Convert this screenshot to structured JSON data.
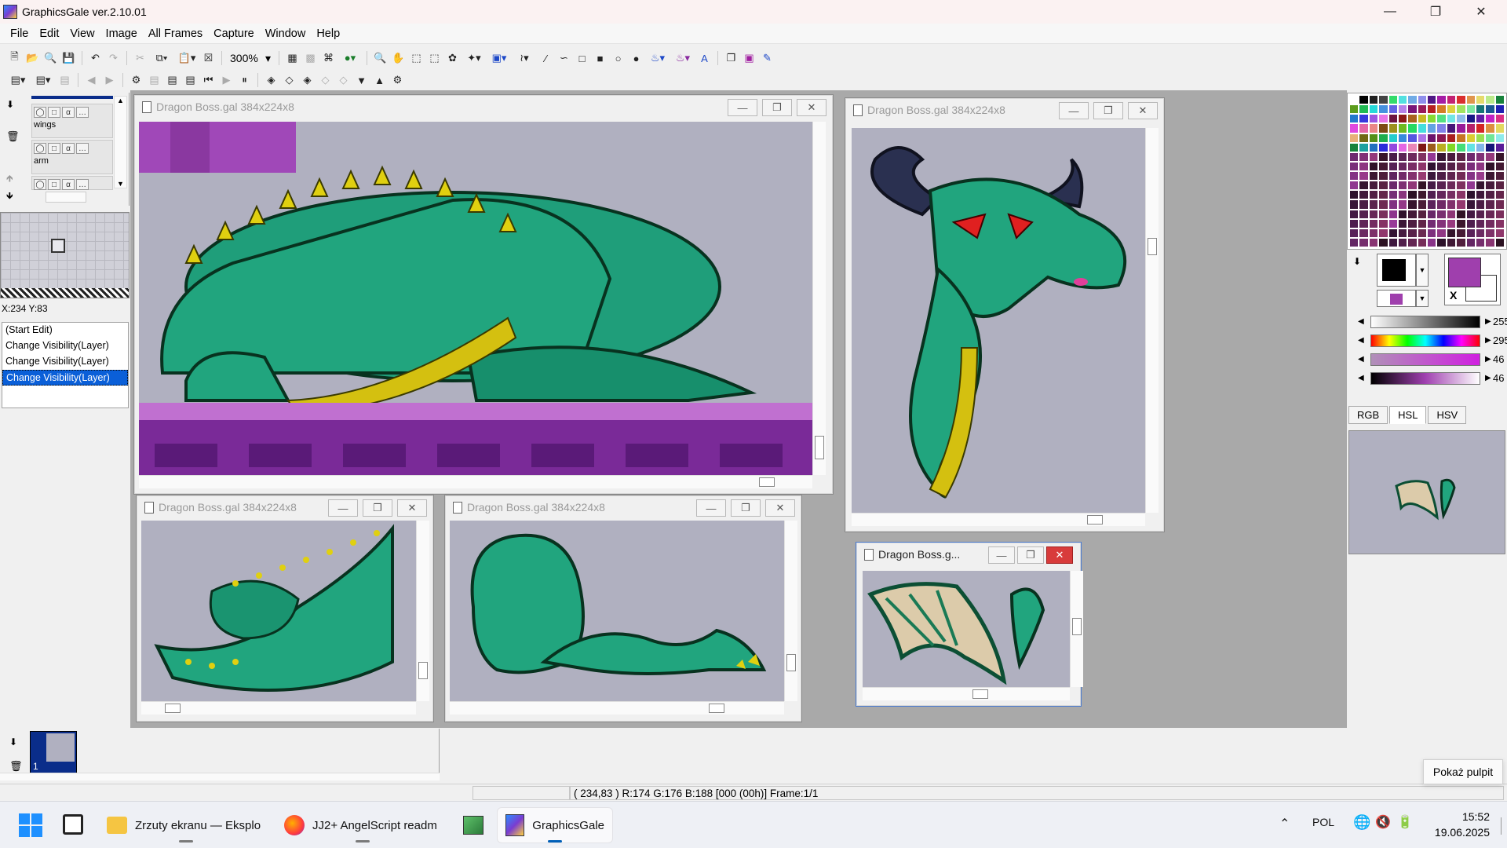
{
  "app": {
    "title": "GraphicsGale ver.2.10.01"
  },
  "menu": [
    "File",
    "Edit",
    "View",
    "Image",
    "All Frames",
    "Capture",
    "Window",
    "Help"
  ],
  "toolbar": {
    "zoom": "300%"
  },
  "layers": [
    {
      "name": "wings"
    },
    {
      "name": "arm"
    }
  ],
  "navigator": {
    "coords": "X:234 Y:83"
  },
  "history": [
    "(Start Edit)",
    "Change Visibility(Layer)",
    "Change Visibility(Layer)",
    "Change Visibility(Layer)"
  ],
  "windows": {
    "main": {
      "title": "Dragon Boss.gal 384x224x8"
    },
    "head": {
      "title": "Dragon Boss.gal 384x224x8"
    },
    "tail": {
      "title": "Dragon Boss.gal 384x224x8"
    },
    "arm": {
      "title": "Dragon Boss.gal 384x224x8"
    },
    "wings": {
      "title": "Dragon Boss.g..."
    }
  },
  "color": {
    "primary": "#000000",
    "secondary": "#9f3fad",
    "transparent_mark": "X",
    "sliders": [
      {
        "value": "255"
      },
      {
        "value": "295"
      },
      {
        "value": "46"
      },
      {
        "value": "46"
      }
    ],
    "tabs": [
      "RGB",
      "HSL",
      "HSV"
    ]
  },
  "frames": {
    "frame1_number": "1"
  },
  "status": {
    "pixel": "( 234,83 ) R:174 G:176 B:188  [000 (00h)]  Frame:1/1"
  },
  "taskbar": {
    "items": [
      {
        "label": "Zrzuty ekranu — Eksplo"
      },
      {
        "label": "JJ2+ AngelScript readm"
      },
      {
        "label": "GraphicsGale"
      }
    ],
    "tray": {
      "lang": "POL",
      "time": "15:52",
      "date": "19.06.2025"
    },
    "tooltip": "Pokaż pulpit"
  }
}
